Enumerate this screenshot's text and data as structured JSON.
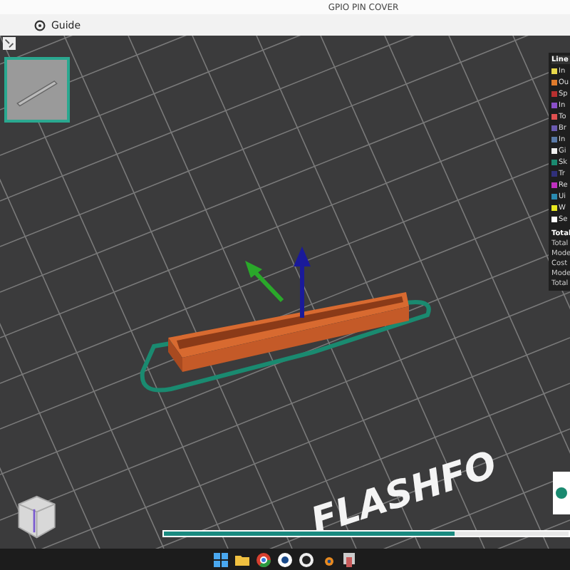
{
  "window": {
    "title": "GPIO PIN COVER"
  },
  "toolbar": {
    "guide_label": "Guide"
  },
  "viewport": {
    "bed_logo": "FLASHFO",
    "progress": {
      "level": 0.72
    }
  },
  "legend": {
    "header": "Line",
    "items": [
      {
        "label": "In",
        "color": "#e8d84a"
      },
      {
        "label": "Ou",
        "color": "#e07b2c"
      },
      {
        "label": "Sp",
        "color": "#b83030"
      },
      {
        "label": "In",
        "color": "#8a4fc8"
      },
      {
        "label": "To",
        "color": "#e05050"
      },
      {
        "label": "Br",
        "color": "#6a5ab0"
      },
      {
        "label": "In",
        "color": "#5a7aa8"
      },
      {
        "label": "Gi",
        "color": "#f0f0f0"
      },
      {
        "label": "Sk",
        "color": "#1a8a70"
      },
      {
        "label": "Tr",
        "color": "#30307a"
      },
      {
        "label": "Re",
        "color": "#c030c0"
      },
      {
        "label": "Ui",
        "color": "#2a8ab0"
      },
      {
        "label": "W",
        "color": "#e8e820"
      },
      {
        "label": "Se",
        "color": "#ffffff"
      }
    ],
    "totals": [
      "Total",
      "Total",
      "Mode",
      "Cost",
      "Mode",
      "Total"
    ]
  }
}
